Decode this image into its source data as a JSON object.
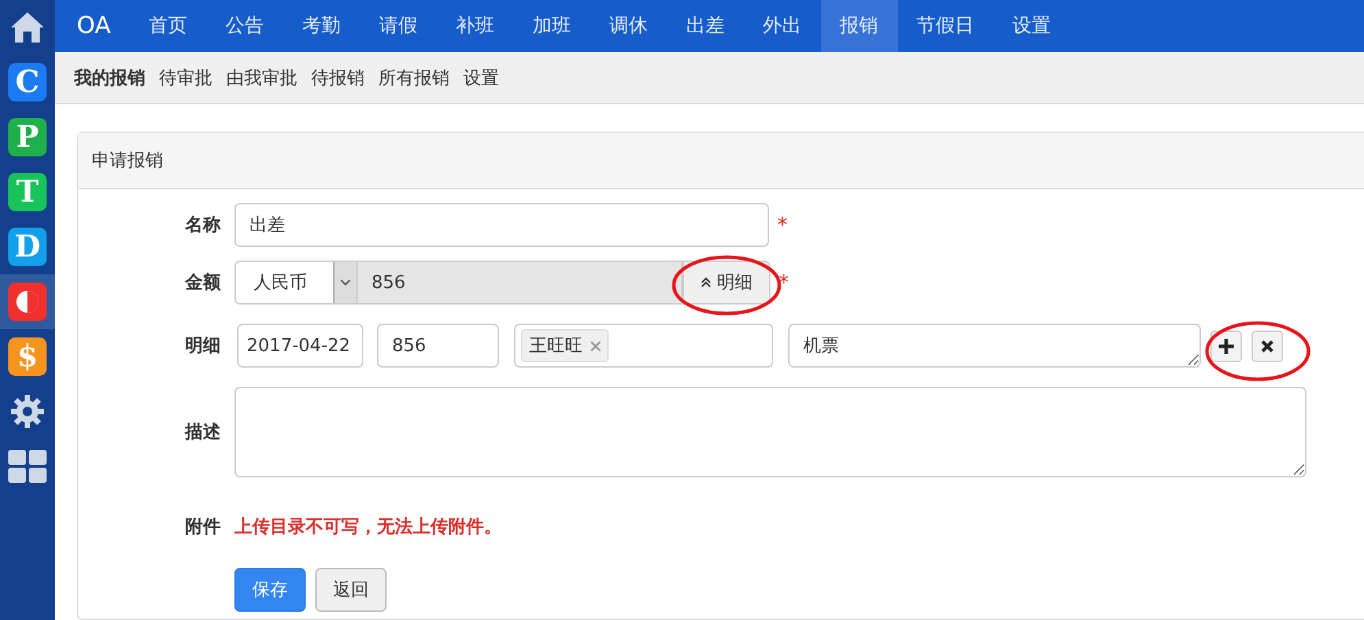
{
  "sidebar": {
    "apps": [
      {
        "kind": "home",
        "selected": false
      },
      {
        "kind": "letter",
        "letter": "C",
        "color": "#1a7bf2",
        "selected": false
      },
      {
        "kind": "letter",
        "letter": "P",
        "color": "#1fb04c",
        "selected": false
      },
      {
        "kind": "letter",
        "letter": "T",
        "color": "#16c45a",
        "selected": false
      },
      {
        "kind": "letter",
        "letter": "D",
        "color": "#12a0ea",
        "selected": false
      },
      {
        "kind": "half",
        "color": "#f0302d",
        "selected": true
      },
      {
        "kind": "letter",
        "letter": "$",
        "color": "#f7941d",
        "selected": false
      },
      {
        "kind": "gear",
        "selected": false
      },
      {
        "kind": "grid",
        "selected": false
      }
    ]
  },
  "top_nav": {
    "brand": "OA",
    "items": [
      {
        "label": "首页",
        "selected": false
      },
      {
        "label": "公告",
        "selected": false
      },
      {
        "label": "考勤",
        "selected": false
      },
      {
        "label": "请假",
        "selected": false
      },
      {
        "label": "补班",
        "selected": false
      },
      {
        "label": "加班",
        "selected": false
      },
      {
        "label": "调休",
        "selected": false
      },
      {
        "label": "出差",
        "selected": false
      },
      {
        "label": "外出",
        "selected": false
      },
      {
        "label": "报销",
        "selected": true
      },
      {
        "label": "节假日",
        "selected": false
      },
      {
        "label": "设置",
        "selected": false
      }
    ]
  },
  "sub_nav": [
    {
      "label": "我的报销",
      "selected": true
    },
    {
      "label": "待审批",
      "selected": false
    },
    {
      "label": "由我审批",
      "selected": false
    },
    {
      "label": "待报销",
      "selected": false
    },
    {
      "label": "所有报销",
      "selected": false
    },
    {
      "label": "设置",
      "selected": false
    }
  ],
  "panel": {
    "title": "申请报销",
    "name": {
      "label": "名称",
      "value": "出差",
      "required_mark": "*"
    },
    "amount": {
      "label": "金额",
      "currency": "人民币",
      "value": "856",
      "detail_button": "明细",
      "required_mark": "*"
    },
    "detail": {
      "label": "明细",
      "date": "2017-04-22",
      "amount": "856",
      "person_tag": "王旺旺",
      "remark": "机票"
    },
    "description": {
      "label": "描述"
    },
    "attachment": {
      "label": "附件",
      "error": "上传目录不可写，无法上传附件。"
    },
    "buttons": [
      {
        "label": "保存",
        "kind": "primary"
      },
      {
        "label": "返回",
        "kind": "default"
      }
    ]
  }
}
